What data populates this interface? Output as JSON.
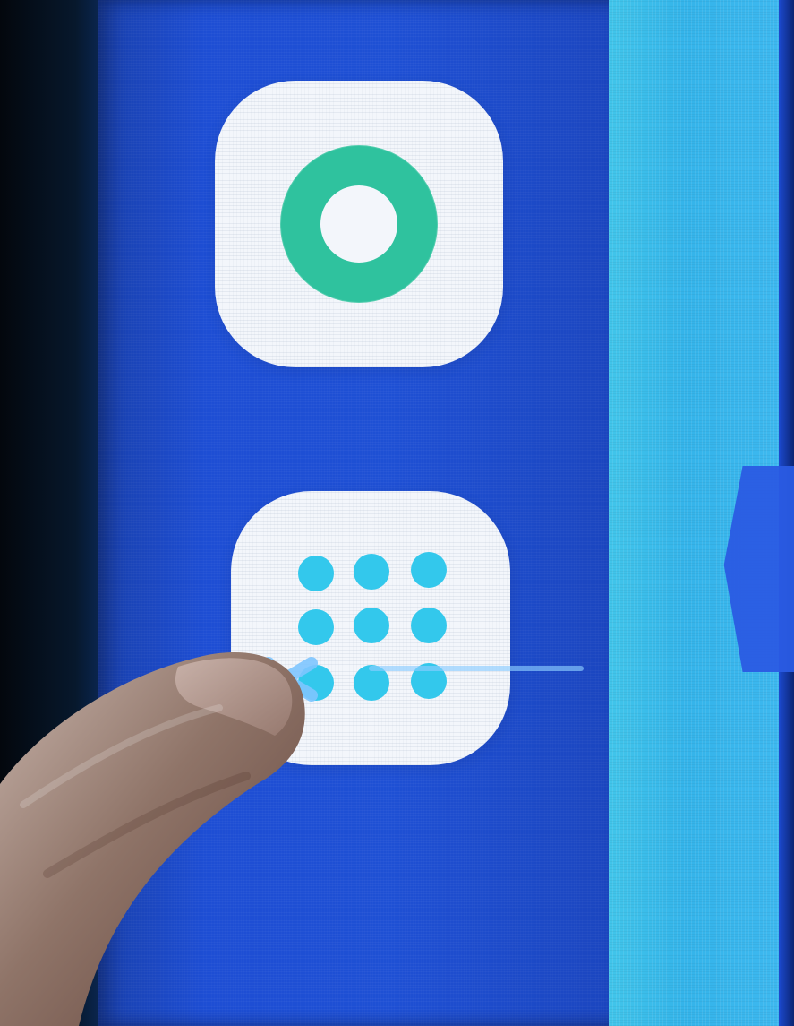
{
  "screen": {
    "background_color": "#1f4fd2",
    "accent_color": "#41c5ea"
  },
  "apps": [
    {
      "icon_name": "ring-icon",
      "accent_color": "#2fc29e"
    },
    {
      "icon_name": "grid-dots-icon",
      "accent_color": "#33c8ec"
    }
  ],
  "navigation": {
    "back_icon_name": "triple-chevron-left-icon"
  },
  "indicator": {
    "color": "#8ccdfd"
  }
}
